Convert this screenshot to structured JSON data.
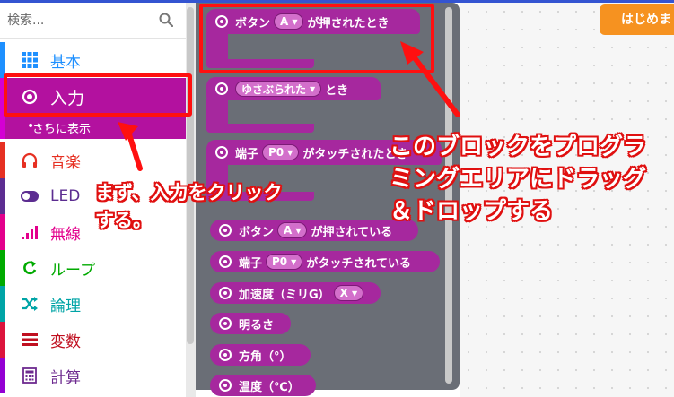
{
  "search": {
    "placeholder": "検索..."
  },
  "categories": [
    {
      "label": "基本",
      "color": "#1e90ff",
      "icon": "grid-icon"
    },
    {
      "label": "入力",
      "color": "#d400d4",
      "icon": "target-icon"
    },
    {
      "label": "さらに表示",
      "color": "#d400d4",
      "icon": "more-icon"
    },
    {
      "label": "音楽",
      "color": "#e63022",
      "icon": "headphones-icon"
    },
    {
      "label": "LED",
      "color": "#5c2d91",
      "icon": "toggle-icon"
    },
    {
      "label": "無線",
      "color": "#e3008c",
      "icon": "signal-icon"
    },
    {
      "label": "ループ",
      "color": "#00aa00",
      "icon": "loop-icon"
    },
    {
      "label": "論理",
      "color": "#00a4a6",
      "icon": "shuffle-icon"
    },
    {
      "label": "変数",
      "color": "#dc143c",
      "icon": "list-icon"
    },
    {
      "label": "計算",
      "color": "#9400d3",
      "icon": "calculator-icon"
    }
  ],
  "blocks": {
    "button_pressed": {
      "pre": "ボタン",
      "pill": "A",
      "post": "が押されたとき"
    },
    "shake": {
      "pill": "ゆさぶられた",
      "post": "とき"
    },
    "pin_touched": {
      "pre": "端子",
      "pill": "P0",
      "post": "がタッチされたとき"
    },
    "button_is_pressed": {
      "pre": "ボタン",
      "pill": "A",
      "post": "が押されている"
    },
    "pin_is_touched": {
      "pre": "端子",
      "pill": "P0",
      "post": "がタッチされている"
    },
    "acceleration": {
      "pre": "加速度（ミリG）",
      "pill": "X"
    },
    "light_level": {
      "label": "明るさ"
    },
    "compass": {
      "label": "方角（°）"
    },
    "temperature": {
      "label": "温度（℃）"
    }
  },
  "workspace": {
    "start_button": "はじめま"
  },
  "annotations": {
    "left": "まず、入力をクリックする。",
    "right": "このブロックをプログラミングエリアにドラッグ＆ドロップする"
  },
  "colors": {
    "block": "#a6289e",
    "highlight": "#ff1010",
    "flyout": "#6a6e76",
    "start_button": "#f69220"
  }
}
